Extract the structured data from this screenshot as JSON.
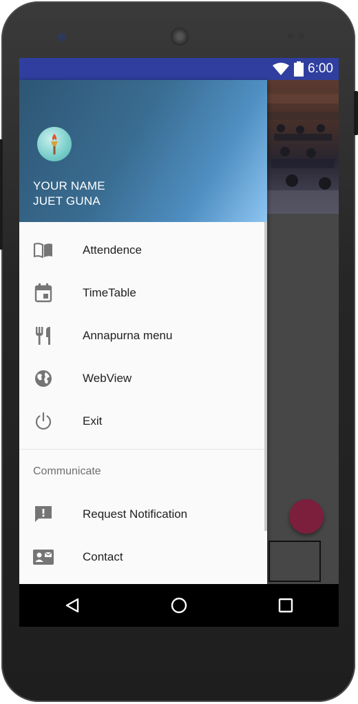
{
  "status_bar": {
    "time": "6:00"
  },
  "drawer": {
    "header": {
      "name": "YOUR NAME",
      "subtitle": "JUET GUNA"
    },
    "items": [
      {
        "label": "Attendence",
        "icon": "book-open-icon"
      },
      {
        "label": "TimeTable",
        "icon": "calendar-icon"
      },
      {
        "label": "Annapurna menu",
        "icon": "restaurant-icon"
      },
      {
        "label": "WebView",
        "icon": "globe-icon"
      },
      {
        "label": "Exit",
        "icon": "power-icon"
      }
    ],
    "section": {
      "title": "Communicate",
      "items": [
        {
          "label": "Request Notification",
          "icon": "feedback-icon"
        },
        {
          "label": "Contact",
          "icon": "contact-card-icon"
        }
      ]
    }
  },
  "colors": {
    "status_bar": "#303f9f",
    "fab": "#7b1f3c",
    "icon": "#757575"
  }
}
